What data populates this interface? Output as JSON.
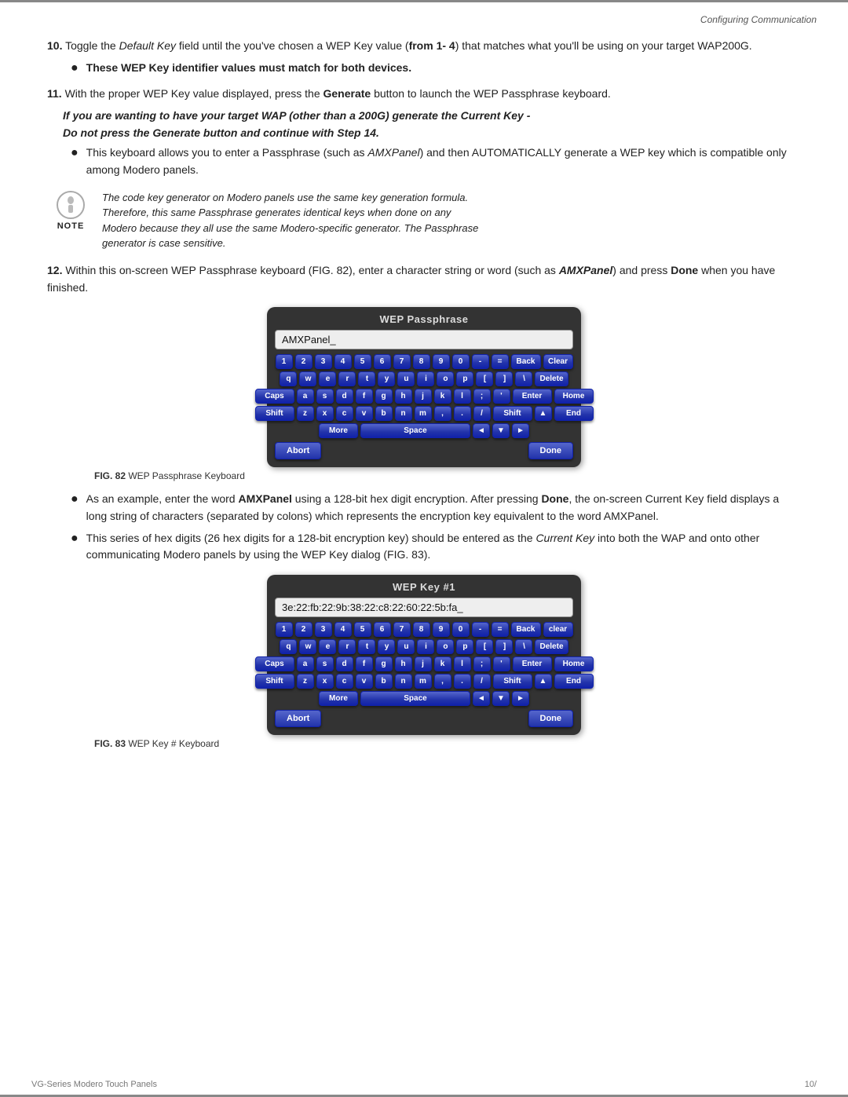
{
  "header": {
    "section": "Configuring Communication"
  },
  "footer": {
    "left": "VG-Series Modero Touch Panels",
    "right": "10/"
  },
  "steps": {
    "step10": {
      "number": "10.",
      "text": "Toggle the ",
      "field1": "Default Key",
      "text2": " field until the you've chosen a WEP Key value (",
      "bold1": "from 1- 4",
      "text3": ") that matches what you'll be using on your target WAP200G.",
      "bullet": "These WEP Key identifier values must match for both devices."
    },
    "step11": {
      "number": "11.",
      "text": "With the proper WEP Key value displayed, press the ",
      "bold1": "Generate",
      "text2": " button to launch the WEP Passphrase keyboard.",
      "italic_line1": "If you are wanting to have your target WAP (other than a 200G) generate the Current Key -",
      "italic_line2": "Do not press the Generate button and continue with Step 14.",
      "bullet": "This keyboard allows you to enter a Passphrase (such as ",
      "bullet_italic": "AMXPanel",
      "bullet_rest": ") and then AUTOMATICALLY generate a WEP key which is compatible only among Modero panels."
    },
    "step12": {
      "number": "12.",
      "text": "Within this on-screen WEP Passphrase keyboard (FIG. 82), enter a character string or word (such as ",
      "bold1": "AMXPanel",
      "text2": ") and press ",
      "bold2": "Done",
      "text3": " when you have finished."
    }
  },
  "note": {
    "lines": [
      "The code key generator on Modero panels use the same key generation formula.",
      "Therefore, this same Passphrase generates identical keys when done on any",
      "Modero because they all use the same Modero-specific generator. The Passphrase",
      "generator is case sensitive."
    ]
  },
  "keyboard1": {
    "title": "WEP Passphrase",
    "input": "AMXPanel_",
    "row1": [
      "1",
      "2",
      "3",
      "4",
      "5",
      "6",
      "7",
      "8",
      "9",
      "0",
      "-",
      "=",
      "Back",
      "Clear"
    ],
    "row2": [
      "q",
      "w",
      "e",
      "r",
      "t",
      "y",
      "u",
      "i",
      "o",
      "p",
      "[",
      "]",
      "\\",
      "Delete"
    ],
    "row3": [
      "Caps",
      "a",
      "s",
      "d",
      "f",
      "g",
      "h",
      "j",
      "k",
      "l",
      ";",
      "'",
      "Enter",
      "Home"
    ],
    "row4": [
      "Shift",
      "z",
      "x",
      "c",
      "v",
      "b",
      "n",
      "m",
      ",",
      ".",
      "/",
      "Shift",
      "▲",
      "End"
    ],
    "row5": [
      "More",
      "Space",
      "◄",
      "▼",
      "►"
    ],
    "abort": "Abort",
    "done": "Done"
  },
  "fig82": {
    "bold": "FIG. 82",
    "text": " WEP Passphrase Keyboard"
  },
  "bullets_after82": {
    "b1_start": "As an example, enter the word ",
    "b1_bold": "AMXPanel",
    "b1_rest": " using a 128-bit hex digit encryption. After pressing ",
    "b1_bold2": "Done",
    "b1_rest2": ", the on-screen Current Key field displays a long string of characters (separated by colons) which represents the encryption key equivalent to the word AMXPanel.",
    "b2_start": "This series of hex digits (26 hex digits for a 128-bit encryption key) should be entered as the ",
    "b2_italic": "Current Key",
    "b2_rest": " into both the WAP and onto other communicating Modero panels by using the WEP Key dialog (FIG. 83)."
  },
  "keyboard2": {
    "title": "WEP Key #1",
    "input": "3e:22:fb:22:9b:38:22:c8:22:60:22:5b:fa_",
    "row1": [
      "1",
      "2",
      "3",
      "4",
      "5",
      "6",
      "7",
      "8",
      "9",
      "0",
      "-",
      "=",
      "Back",
      "clear"
    ],
    "row2": [
      "q",
      "w",
      "e",
      "r",
      "t",
      "y",
      "u",
      "i",
      "o",
      "p",
      "[",
      "]",
      "\\",
      "Delete"
    ],
    "row3": [
      "Caps",
      "a",
      "s",
      "d",
      "f",
      "g",
      "h",
      "j",
      "k",
      "l",
      ";",
      "'",
      "Enter",
      "Home"
    ],
    "row4": [
      "Shift",
      "z",
      "x",
      "c",
      "v",
      "b",
      "n",
      "m",
      ",",
      ".",
      "/",
      "Shift",
      "▲",
      "End"
    ],
    "row5": [
      "More",
      "Space",
      "◄",
      "▼",
      "►"
    ],
    "abort": "Abort",
    "done": "Done"
  },
  "fig83": {
    "bold": "FIG. 83",
    "text": " WEP Key # Keyboard"
  },
  "labels": {
    "note": "NOTE",
    "back": "Back",
    "clear": "Clear",
    "delete": "Delete",
    "home": "Home",
    "enter": "Enter",
    "caps": "Caps",
    "shift": "Shift",
    "end": "End",
    "more": "More",
    "space": "Space",
    "abort": "Abort",
    "done": "Done"
  }
}
